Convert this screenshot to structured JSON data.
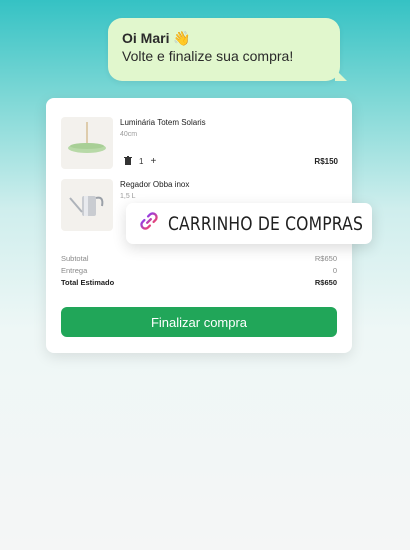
{
  "bubble": {
    "greeting": "Oi Mari 👋",
    "message": "Volte e finalize sua compra!"
  },
  "cart": {
    "items": [
      {
        "name": "Luminária Totem Solaris",
        "variant": "40cm",
        "quantity": "1",
        "price": "R$150"
      },
      {
        "name": "Regador Obba inox",
        "variant": "1,5 L"
      }
    ],
    "summary": {
      "subtotal_label": "Subtotal",
      "subtotal_value": "R$650",
      "shipping_label": "Entrega",
      "shipping_value": "0",
      "total_label": "Total Estimado",
      "total_value": "R$650"
    },
    "checkout_label": "Finalizar compra"
  },
  "tag": {
    "label": "CARRINHO DE COMPRAS",
    "icon": "chain-link-icon"
  },
  "colors": {
    "primary_green": "#21a659",
    "bubble_bg": "#e1f7cd",
    "icon_gradient": [
      "#8b3cf0",
      "#f0456b"
    ]
  }
}
